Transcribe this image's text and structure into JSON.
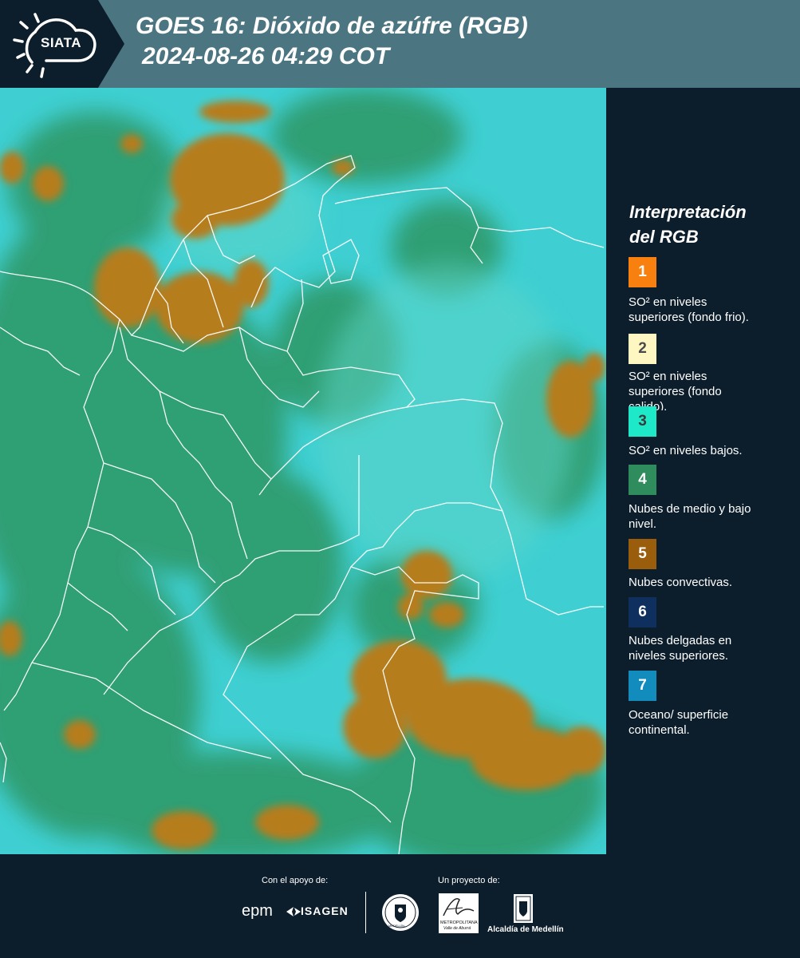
{
  "header": {
    "logo": "SIATA",
    "title_line1": "GOES 16: Dióxido de azúfre (RGB)",
    "title_line2": "2024-08-26 04:29 COT"
  },
  "legend": {
    "title_line1": "Interpretación",
    "title_line2": "del RGB",
    "items": [
      {
        "number": "1",
        "color": "#f7800f",
        "text_color": "#ffffff",
        "line1": "SO² en niveles",
        "line2": "superiores (fondo frio)."
      },
      {
        "number": "2",
        "color": "#fff7c2",
        "text_color": "#4a4a4a",
        "line1": "SO² en niveles",
        "line2": "superiores (fondo",
        "line3": "calido)."
      },
      {
        "number": "3",
        "color": "#1de9c8",
        "text_color": "#3a3a3a",
        "line1": "SO² en niveles bajos."
      },
      {
        "number": "4",
        "color": "#2f8c5d",
        "text_color": "#ffffff",
        "line1": "Nubes de medio y bajo",
        "line2": "nivel."
      },
      {
        "number": "5",
        "color": "#9a5d0c",
        "text_color": "#ffffff",
        "line1": "Nubes convectivas."
      },
      {
        "number": "6",
        "color": "#0f2f5f",
        "text_color": "#ffffff",
        "line1": "Nubes delgadas en",
        "line2": "niveles superiores."
      },
      {
        "number": "7",
        "color": "#118cbc",
        "text_color": "#ffffff",
        "line1": "Oceano/ superficie",
        "line2": "continental."
      }
    ]
  },
  "footer": {
    "support_label": "Con el apoyo de:",
    "project_label": "Un proyecto de:",
    "sponsor1": "epm",
    "sponsor2": "ISAGEN",
    "partner1": "MEDELLÍN",
    "partner2_line1": "METROPOLITANA",
    "partner2_line2": "Valle de Aburrá",
    "partner3": "Alcaldía de Medellín"
  },
  "map": {
    "name": "goes16-so2-rgb-image"
  }
}
